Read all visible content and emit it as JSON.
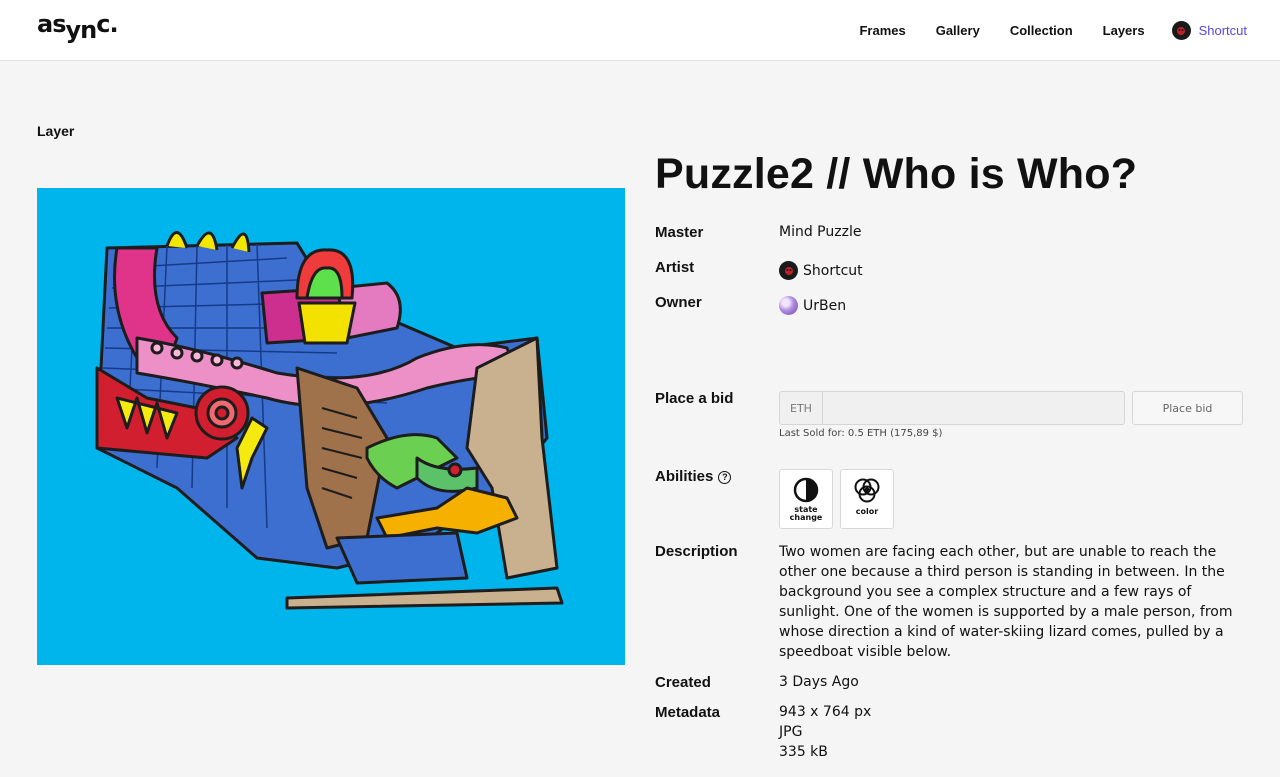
{
  "header": {
    "logo": "asynс.",
    "nav": [
      "Frames",
      "Gallery",
      "Collection",
      "Layers"
    ],
    "user_name": "Shortcut"
  },
  "page": {
    "section_label": "Layer",
    "title": "Puzzle2 // Who is Who?"
  },
  "details": {
    "master_label": "Master",
    "master_value": "Mind Puzzle",
    "artist_label": "Artist",
    "artist_value": "Shortcut",
    "owner_label": "Owner",
    "owner_value": "UrBen"
  },
  "bid": {
    "label": "Place a bid",
    "currency": "ETH",
    "input_value": "",
    "button": "Place bid",
    "last_sold": "Last Sold for: 0.5 ETH (175,89 $)"
  },
  "abilities": {
    "label": "Abilities",
    "items": [
      {
        "label": "state change",
        "icon": "half-circle-icon"
      },
      {
        "label": "color",
        "icon": "color-circles-icon"
      }
    ]
  },
  "description": {
    "label": "Description",
    "text": "Two women are facing each other, but are unable to reach the other one because a third person is standing in between. In the background you see a complex structure and a few rays of sunlight. One of the women is supported by a male person, from whose direction a kind of water-skiing lizard comes, pulled by a speedboat visible below."
  },
  "created": {
    "label": "Created",
    "value": "3 Days Ago"
  },
  "metadata": {
    "label": "Metadata",
    "dimensions": "943 x 764 px",
    "format": "JPG",
    "size": "335 kB"
  },
  "colors": {
    "accent": "#5a48d8",
    "artwork_bg": "#00b4ec"
  }
}
